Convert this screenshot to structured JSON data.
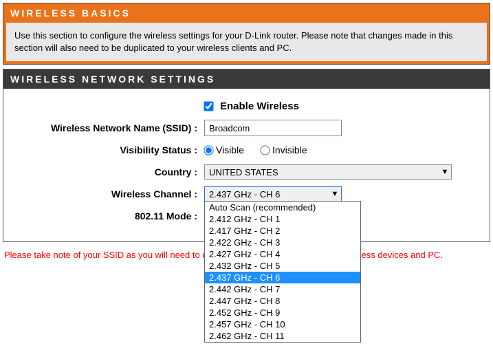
{
  "basics": {
    "title": "WIRELESS BASICS",
    "text": "Use this section to configure the wireless settings for your D-Link router. Please note that changes made in this section will also need to be duplicated to your wireless clients and PC."
  },
  "settings": {
    "title": "WIRELESS NETWORK SETTINGS",
    "enable_label": "Enable Wireless",
    "enable_checked": true,
    "ssid_label": "Wireless Network Name (SSID) :",
    "ssid_value": "Broadcom",
    "visibility_label": "Visibility Status :",
    "visibility_visible": "Visible",
    "visibility_invisible": "Invisible",
    "visibility_selected": "visible",
    "country_label": "Country :",
    "country_value": "UNITED STATES",
    "channel_label": "Wireless Channel :",
    "channel_value": "2.437 GHz - CH 6",
    "channel_options": [
      "Auto Scan (recommended)",
      "2.412 GHz - CH 1",
      "2.417 GHz - CH 2",
      "2.422 GHz - CH 3",
      "2.427 GHz - CH 4",
      "2.432 GHz - CH 5",
      "2.437 GHz - CH 6",
      "2.442 GHz - CH 7",
      "2.447 GHz - CH 8",
      "2.452 GHz - CH 9",
      "2.457 GHz - CH 10",
      "2.462 GHz - CH 11"
    ],
    "channel_selected_index": 6,
    "mode_label": "802.11 Mode :",
    "mode_value": ""
  },
  "note": "Please take note of your SSID as you will need to duplicate the same settings to your wireless devices and PC."
}
